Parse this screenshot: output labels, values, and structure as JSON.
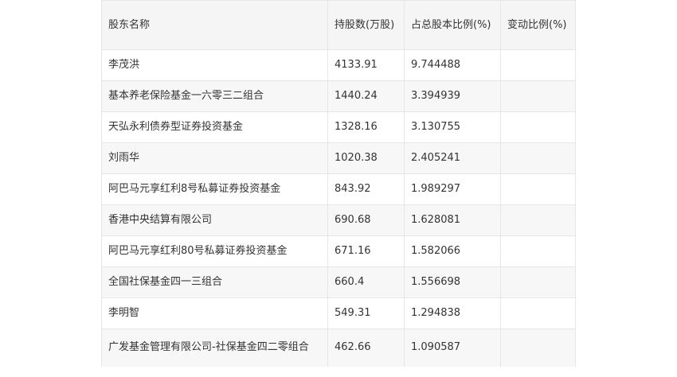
{
  "table": {
    "headers": [
      "股东名称",
      "持股数(万股)",
      "占总股本比例(%)",
      "变动比例(%)"
    ],
    "rows": [
      {
        "name": "李茂洪",
        "shares": "4133.91",
        "ratio": "9.744488",
        "change": ""
      },
      {
        "name": "基本养老保险基金一六零三二组合",
        "shares": "1440.24",
        "ratio": "3.394939",
        "change": ""
      },
      {
        "name": "天弘永利债券型证券投资基金",
        "shares": "1328.16",
        "ratio": "3.130755",
        "change": ""
      },
      {
        "name": "刘雨华",
        "shares": "1020.38",
        "ratio": "2.405241",
        "change": ""
      },
      {
        "name": "阿巴马元享红利8号私募证券投资基金",
        "shares": "843.92",
        "ratio": "1.989297",
        "change": ""
      },
      {
        "name": "香港中央结算有限公司",
        "shares": "690.68",
        "ratio": "1.628081",
        "change": ""
      },
      {
        "name": "阿巴马元享红利80号私募证券投资基金",
        "shares": "671.16",
        "ratio": "1.582066",
        "change": ""
      },
      {
        "name": "全国社保基金四一三组合",
        "shares": "660.4",
        "ratio": "1.556698",
        "change": ""
      },
      {
        "name": "李明智",
        "shares": "549.31",
        "ratio": "1.294838",
        "change": ""
      },
      {
        "name": "广发基金管理有限公司-社保基金四二零组合",
        "shares": "462.66",
        "ratio": "1.090587",
        "change": ""
      }
    ]
  }
}
